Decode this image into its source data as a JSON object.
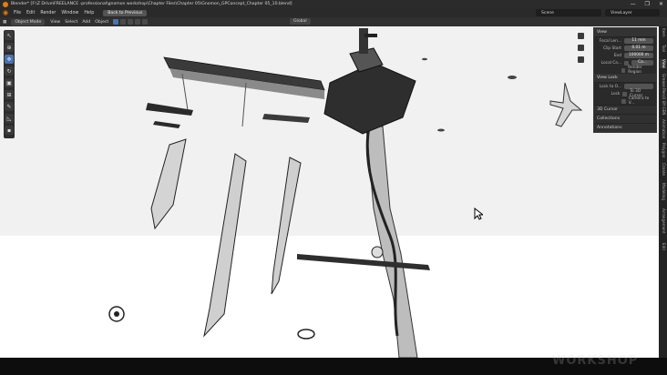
{
  "window": {
    "title": "Blender* [F:\\Z Drive\\FREELANCE -professional\\gnomon workshop\\Chapter Files\\Chapter 05\\Gnomon_GPConcept_Chapter 05_10.blend]",
    "minimize": "—",
    "maximize": "❐",
    "close": "✕"
  },
  "menubar": {
    "items": [
      "File",
      "Edit",
      "Render",
      "Window",
      "Help"
    ],
    "back_button": "Back to Previous",
    "scene": "Scene",
    "view_layer": "ViewLayer"
  },
  "header": {
    "mode": "Object Mode",
    "menus": [
      "View",
      "Select",
      "Add",
      "Object"
    ],
    "transform_orientation": "Global"
  },
  "npanel": {
    "view_section": "View",
    "focal_length_label": "Focal Len...",
    "focal_length_value": "11 mm",
    "clip_start_label": "Clip Start",
    "clip_start_value": "0.01 m",
    "clip_end_label": "End",
    "clip_end_value": "100000 m",
    "local_camera_label": "Local Ca...",
    "local_camera_value": "Ca...",
    "render_region_label": "Render Region",
    "view_lock_section": "View Lock",
    "lock_to_object_label": "Lock to O...",
    "lock_label": "Lock",
    "to_3d_cursor_label": "To 3D Cursor",
    "camera_to_view_label": "Camera to V...",
    "collapsed_sections": [
      "3D Cursor",
      "Collections",
      "Annotations"
    ]
  },
  "sidebar_tabs": [
    "Item",
    "Tool",
    "View",
    "Grease Pencil",
    "BY-GEN",
    "Animation",
    "Polygon",
    "Create",
    "Modeling",
    "Arrangement",
    "Edit"
  ],
  "watermark": "WORKSHOP",
  "colors": {
    "accent_blue": "#4772b3",
    "blender_orange": "#e87d0d",
    "viewport_bg": "#f1f1f1"
  }
}
